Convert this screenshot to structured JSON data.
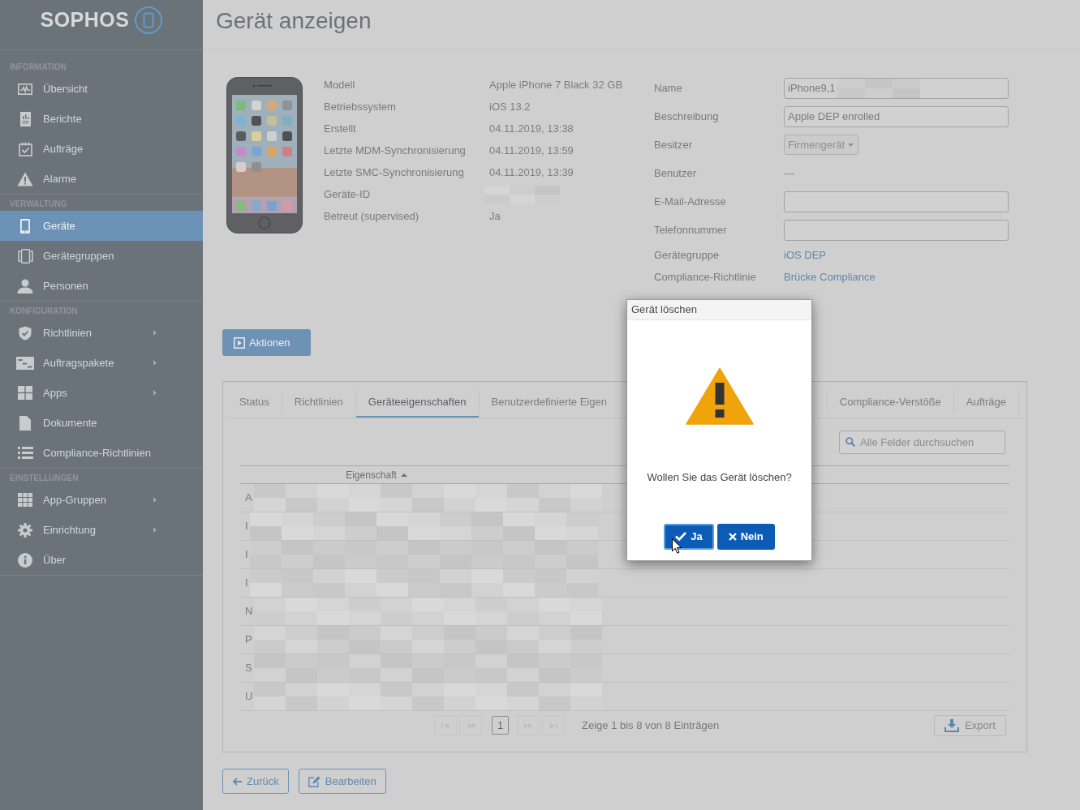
{
  "sidebar": {
    "logo": "SOPHOS",
    "sections": [
      {
        "heading": "INFORMATION",
        "items": [
          {
            "label": "Übersicht",
            "selected": false,
            "submenu": false
          },
          {
            "label": "Berichte",
            "selected": false,
            "submenu": false
          },
          {
            "label": "Aufträge",
            "selected": false,
            "submenu": false
          },
          {
            "label": "Alarme",
            "selected": false,
            "submenu": false
          }
        ]
      },
      {
        "heading": "VERWALTUNG",
        "items": [
          {
            "label": "Geräte",
            "selected": true,
            "submenu": false
          },
          {
            "label": "Gerätegruppen",
            "selected": false,
            "submenu": false
          },
          {
            "label": "Personen",
            "selected": false,
            "submenu": false
          }
        ]
      },
      {
        "heading": "KONFIGURATION",
        "items": [
          {
            "label": "Richtlinien",
            "selected": false,
            "submenu": true
          },
          {
            "label": "Auftragspakete",
            "selected": false,
            "submenu": true
          },
          {
            "label": "Apps",
            "selected": false,
            "submenu": true
          },
          {
            "label": "Dokumente",
            "selected": false,
            "submenu": false
          },
          {
            "label": "Compliance-Richtlinien",
            "selected": false,
            "submenu": false
          }
        ]
      },
      {
        "heading": "EINSTELLUNGEN",
        "items": [
          {
            "label": "App-Gruppen",
            "selected": false,
            "submenu": true
          },
          {
            "label": "Einrichtung",
            "selected": false,
            "submenu": true
          },
          {
            "label": "Über",
            "selected": false,
            "submenu": false
          }
        ]
      }
    ]
  },
  "page_title": "Gerät anzeigen",
  "device": {
    "details": [
      {
        "label": "Modell",
        "value": "Apple iPhone 7 Black 32 GB",
        "redacted": false
      },
      {
        "label": "Betriebssystem",
        "value": "iOS 13.2",
        "redacted": false
      },
      {
        "label": "Erstellt",
        "value": "04.11.2019, 13:38",
        "redacted": false
      },
      {
        "label": "Letzte MDM-Synchronisierung",
        "value": "04.11.2019, 13:59",
        "redacted": false
      },
      {
        "label": "Letzte SMC-Synchronisierung",
        "value": "04.11.2019, 13:39",
        "redacted": false
      },
      {
        "label": "Geräte-ID",
        "redacted": true
      },
      {
        "label": "Betreut (supervised)",
        "value": "Ja",
        "redacted": false
      }
    ]
  },
  "form": {
    "fields": [
      {
        "label": "Name",
        "kind": "input",
        "value": "iPhone9,1",
        "redacted": true,
        "disabled": false
      },
      {
        "label": "Beschreibung",
        "kind": "input",
        "value": "Apple DEP enrolled",
        "redacted": false,
        "disabled": false
      },
      {
        "label": "Besitzer",
        "kind": "select",
        "value": "Firmengerät",
        "redacted": false,
        "disabled": true
      },
      {
        "label": "Benutzer",
        "kind": "text",
        "value": "---",
        "redacted": false,
        "disabled": false
      },
      {
        "label": "E-Mail-Adresse",
        "kind": "input",
        "redacted": false,
        "disabled": false
      },
      {
        "label": "Telefonnummer",
        "kind": "input",
        "redacted": false,
        "disabled": false
      },
      {
        "label": "Gerätegruppe",
        "kind": "link",
        "value": "iOS DEP",
        "redacted": false,
        "disabled": false
      },
      {
        "label": "Compliance-Richtlinie",
        "kind": "link",
        "value": "Brücke Compliance",
        "redacted": false,
        "disabled": false
      }
    ]
  },
  "actions_button": "Aktionen",
  "tabs": [
    {
      "label": "Status",
      "selected": false
    },
    {
      "label": "Richtlinien",
      "selected": false
    },
    {
      "label": "Geräteeigenschaften",
      "selected": true
    },
    {
      "label": "Benutzerdefinierte Eigen",
      "selected": false
    },
    {
      "label": "Compliance-Verstöße",
      "selected": false
    },
    {
      "label": "Aufträge",
      "selected": false
    }
  ],
  "search": {
    "placeholder": "Alle Felder durchsuchen"
  },
  "table": {
    "columns": [
      {
        "label": "Eigenschaft",
        "sorted": true
      }
    ],
    "rows": [
      {
        "column_1": "A",
        "redacted": true
      },
      {
        "column_1": "I",
        "redacted": true
      },
      {
        "column_1": "I",
        "redacted": true
      },
      {
        "column_1": "I",
        "redacted": true
      },
      {
        "column_1": "N",
        "redacted": true
      },
      {
        "column_1": "P",
        "redacted": true
      },
      {
        "column_1": "S",
        "redacted": true
      },
      {
        "column_1": "U",
        "redacted": true
      }
    ]
  },
  "pagination": {
    "nav_buttons": [
      {
        "kind": "first",
        "disabled": true
      },
      {
        "kind": "previous",
        "disabled": true
      },
      {
        "kind": "next",
        "disabled": true
      },
      {
        "kind": "last",
        "disabled": true
      }
    ],
    "pages": [
      {
        "label": "1",
        "selected": true
      }
    ],
    "summary": "Zeige 1 bis 8 von 8 Einträgen",
    "export_button": "Export"
  },
  "footer_buttons": [
    {
      "label": "Zurück",
      "kind": "back"
    },
    {
      "label": "Bearbeiten",
      "kind": "edit"
    }
  ],
  "dialog": {
    "title": "Gerät löschen",
    "message": "Wollen Sie das Gerät löschen?",
    "buttons": [
      {
        "label": "Ja",
        "kind": "confirm",
        "focused": true
      },
      {
        "label": "Nein",
        "kind": "cancel",
        "focused": false
      }
    ]
  }
}
